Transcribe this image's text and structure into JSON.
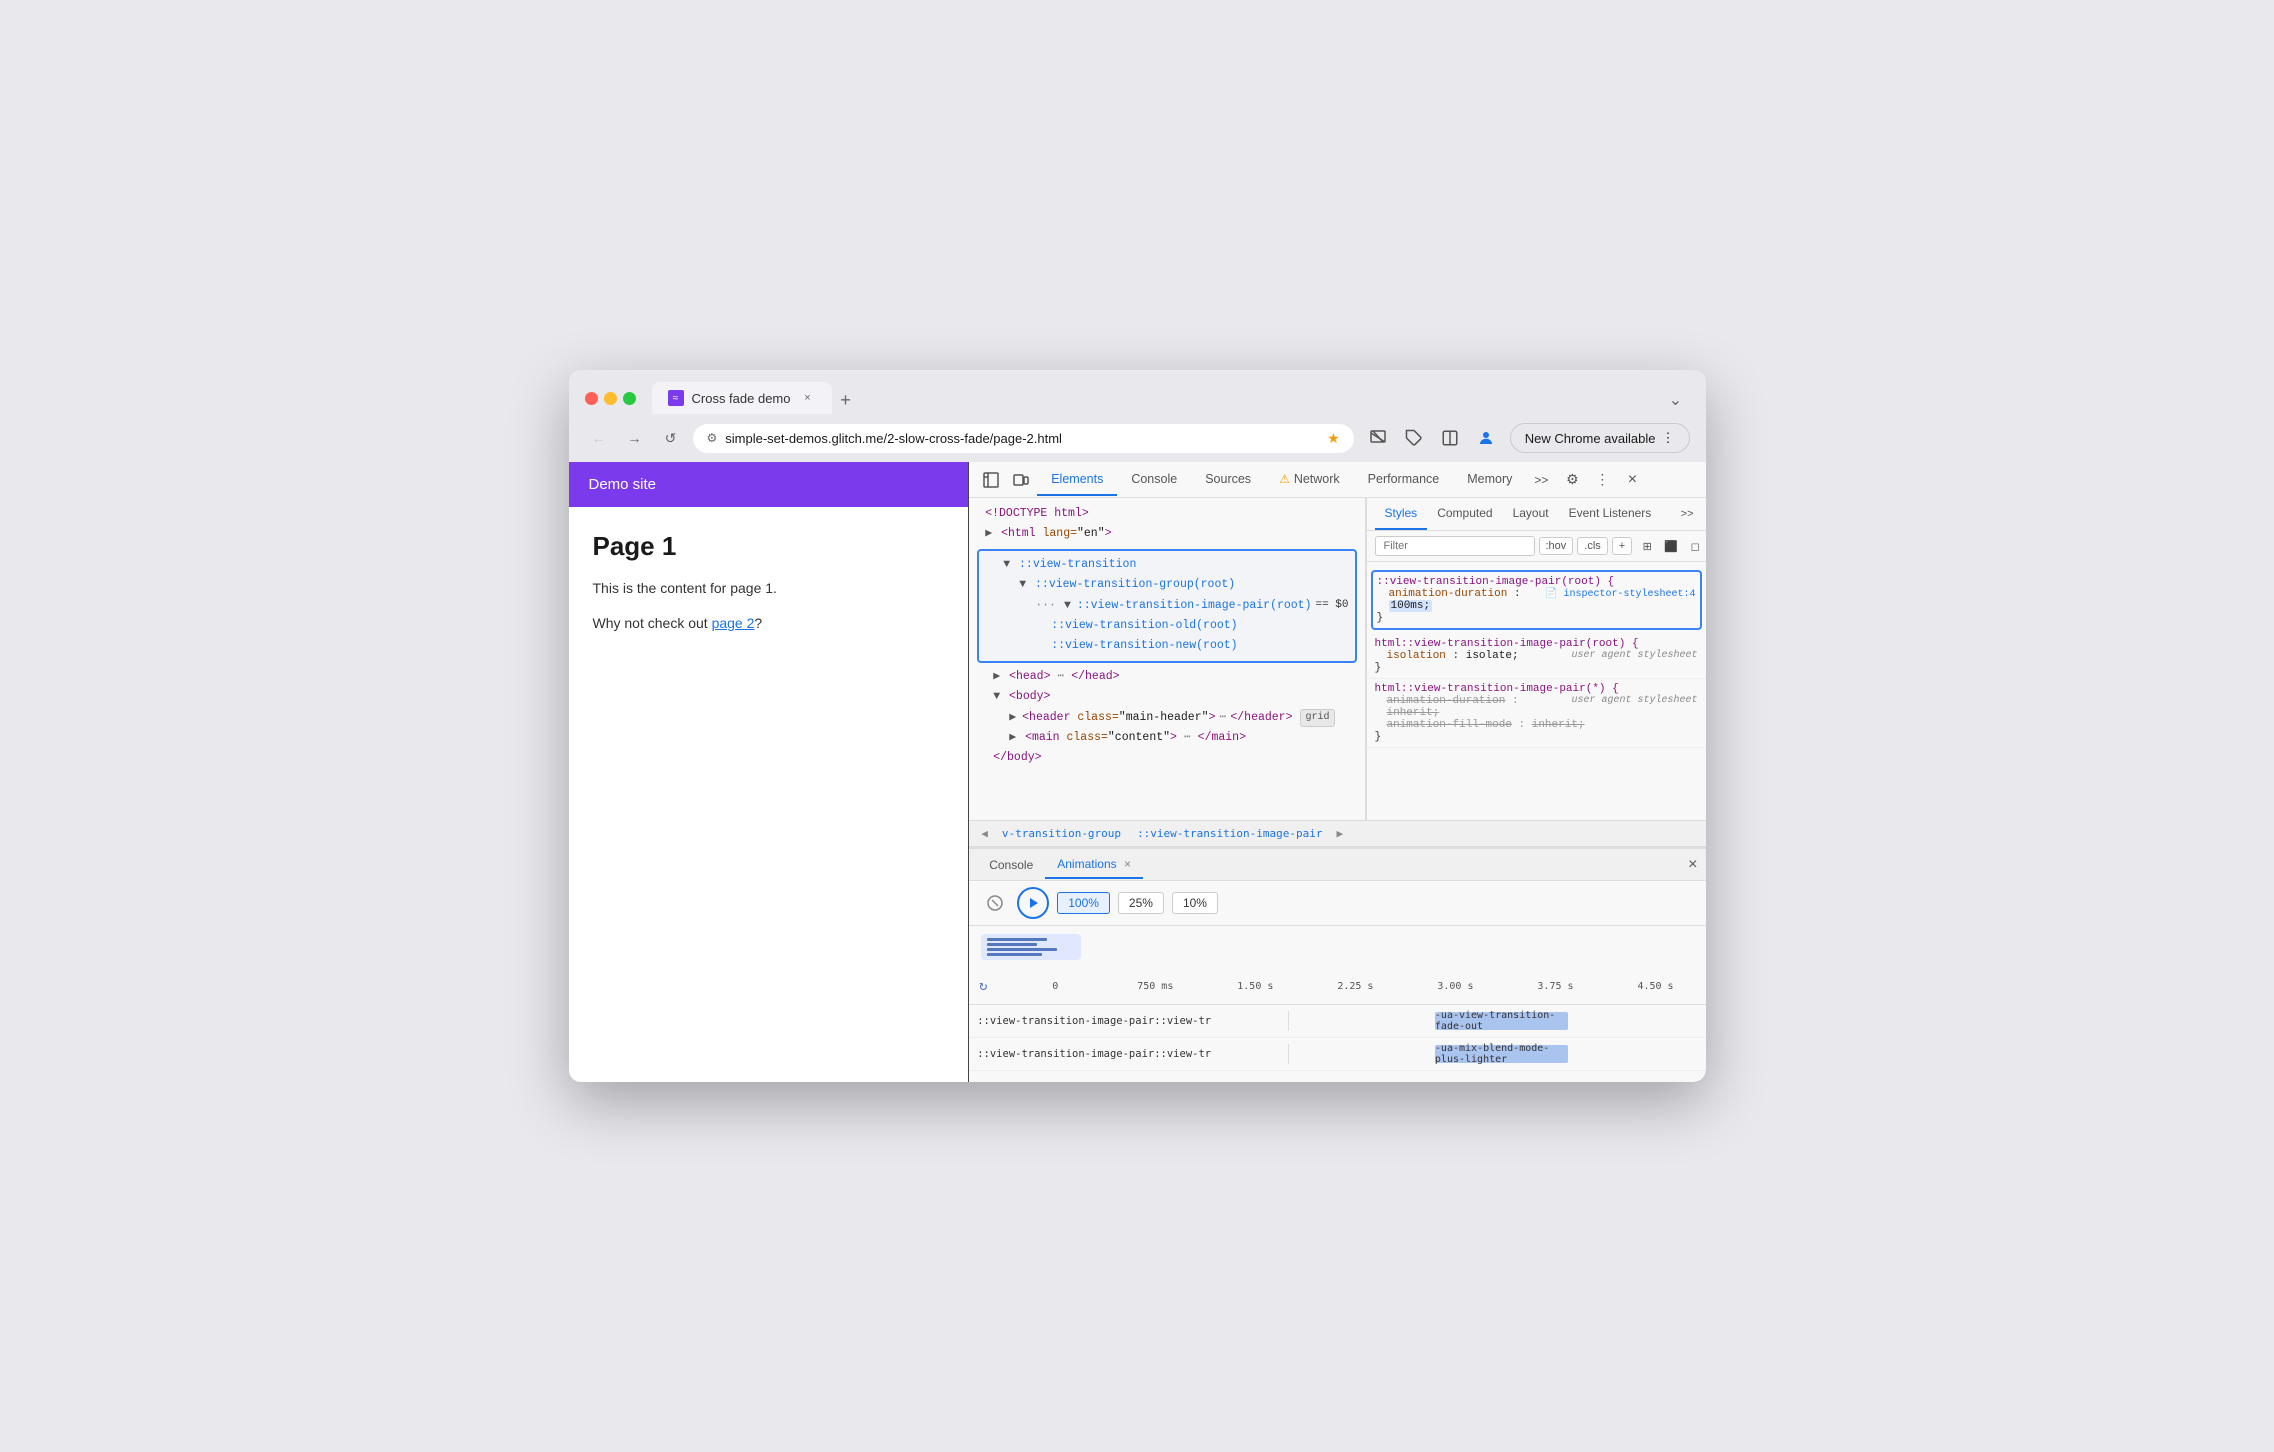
{
  "browser": {
    "tab_title": "Cross fade demo",
    "tab_close": "×",
    "new_tab": "+",
    "tab_overflow": "⌄",
    "url": "simple-set-demos.glitch.me/2-slow-cross-fade/page-2.html",
    "new_chrome_label": "New Chrome available",
    "nav_back": "←",
    "nav_forward": "→",
    "nav_reload": "↺"
  },
  "page": {
    "site_name": "Demo site",
    "title": "Page 1",
    "paragraph1": "This is the content for page 1.",
    "paragraph2_prefix": "Why not check out ",
    "page2_link": "page 2",
    "paragraph2_suffix": "?"
  },
  "devtools": {
    "tabs": [
      "Elements",
      "Console",
      "Sources",
      "Network",
      "Performance",
      "Memory"
    ],
    "network_warning": "⚠",
    "tab_overflow": ">>",
    "close": "×",
    "styles_tabs": [
      "Styles",
      "Computed",
      "Layout",
      "Event Listeners"
    ],
    "styles_tab_overflow": ">>",
    "filter_placeholder": "Filter",
    "filter_hov": ":hov",
    "filter_cls": ".cls",
    "filter_plus": "+",
    "elements": {
      "lines": [
        {
          "indent": 0,
          "text": "<!DOCTYPE html>"
        },
        {
          "indent": 0,
          "text": "<html lang=\"en\">"
        },
        {
          "indent": 1,
          "highlighted": true,
          "children": [
            {
              "text": "::view-transition"
            },
            {
              "text": "::view-transition-group(root)"
            },
            {
              "text": "::view-transition-image-pair(root) == $0"
            },
            {
              "text": "::view-transition-old(root)"
            },
            {
              "text": "::view-transition-new(root)"
            }
          ]
        },
        {
          "indent": 1,
          "text": "<head>... </head>"
        },
        {
          "indent": 1,
          "text": "<body>"
        },
        {
          "indent": 2,
          "text": "<header class=\"main-header\"> ⋯ </header>",
          "badge": "grid"
        },
        {
          "indent": 2,
          "text": "<main class=\"content\"> ⋯ </main>"
        },
        {
          "indent": 1,
          "text": "</body>"
        }
      ]
    },
    "breadcrumb": {
      "prev_arrow": "◀",
      "next_arrow": "▶",
      "items": [
        "v-transition-group",
        "::view-transition-image-pair"
      ]
    },
    "styles": {
      "highlighted_rule": {
        "selector": "::view-transition-image-pair(root) {",
        "source": "inspector-stylesheet:4",
        "source_icon": "📄",
        "prop": "animation-duration",
        "val": "100ms;",
        "close_brace": "}"
      },
      "rules": [
        {
          "selector": "html::view-transition-image-pair(root) {",
          "source_label": "user agent stylesheet",
          "props": [
            {
              "name": "isolation",
              "val": "isolate;"
            }
          ],
          "close_brace": "}"
        },
        {
          "selector": "html::view-transition-image-pair(*) {",
          "source_label": "user agent stylesheet",
          "props": [
            {
              "name": "animation-duration",
              "val": "inherit;",
              "strikethrough": true
            },
            {
              "name": "animation-fill-mode",
              "val": "inherit;",
              "strikethrough": true
            }
          ],
          "close_brace": "}"
        }
      ]
    },
    "animations": {
      "console_tab": "Console",
      "anim_tab": "Animations",
      "tab_close": "×",
      "close": "×",
      "speeds": [
        "100%",
        "25%",
        "10%"
      ],
      "timeline_marks": [
        "0",
        "750 ms",
        "1.50 s",
        "2.25 s",
        "3.00 s",
        "3.75 s",
        "4.50 s"
      ],
      "rows": [
        {
          "label": "::view-transition-image-pair::view-tr",
          "bar_label": "-ua-view-transition-fade-out",
          "bar_left_pct": 42,
          "bar_width_pct": 30
        },
        {
          "label": "::view-transition-image-pair::view-tr",
          "bar_label": "-ua-mix-blend-mode-plus-lighter",
          "bar_left_pct": 42,
          "bar_width_pct": 30
        }
      ]
    }
  },
  "colors": {
    "accent_purple": "#7c3aed",
    "accent_blue": "#1a73e8",
    "highlight_border": "#3b82f6",
    "warning_yellow": "#f59e0b"
  }
}
